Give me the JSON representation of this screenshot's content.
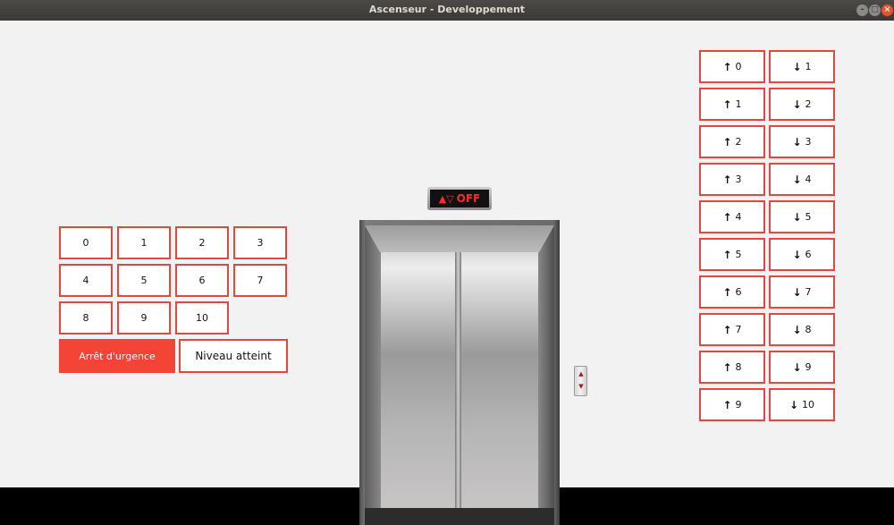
{
  "window": {
    "title": "Ascenseur - Developpement"
  },
  "cabin_panel": {
    "floors": [
      "0",
      "1",
      "2",
      "3",
      "4",
      "5",
      "6",
      "7",
      "8",
      "9",
      "10"
    ],
    "emergency_label": "Arrêt d'urgence",
    "reached_label": "Niveau atteint"
  },
  "display": {
    "text": "OFF",
    "icon": "up-down-triangles-icon"
  },
  "hall_calls": [
    {
      "up": "0",
      "down": "1"
    },
    {
      "up": "1",
      "down": "2"
    },
    {
      "up": "2",
      "down": "3"
    },
    {
      "up": "3",
      "down": "4"
    },
    {
      "up": "4",
      "down": "5"
    },
    {
      "up": "5",
      "down": "6"
    },
    {
      "up": "6",
      "down": "7"
    },
    {
      "up": "7",
      "down": "8"
    },
    {
      "up": "8",
      "down": "9"
    },
    {
      "up": "9",
      "down": "10"
    }
  ],
  "colors": {
    "accent": "#e4473f",
    "emergency_bg": "#f44436",
    "display_text": "#ff2b2b"
  }
}
